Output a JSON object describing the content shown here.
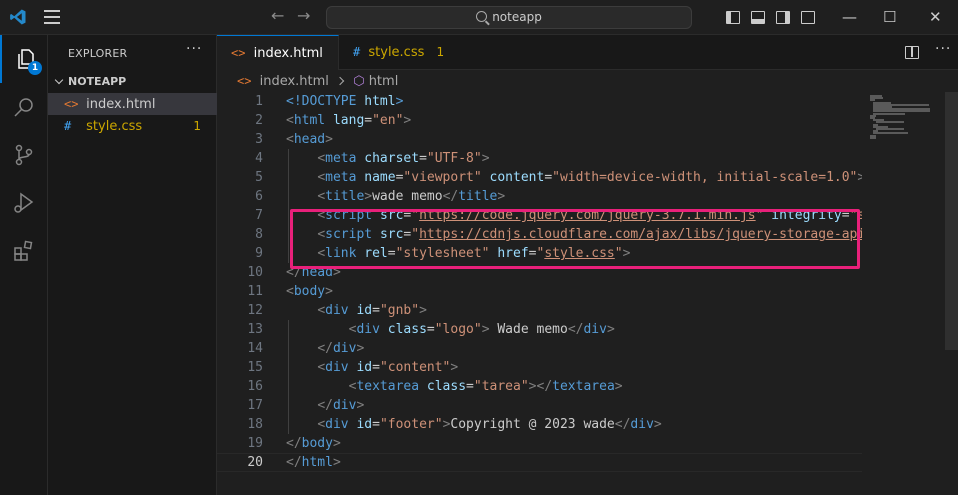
{
  "titlebar": {
    "search_text": "noteapp",
    "nav_back": "←",
    "nav_forward": "→",
    "minimize": "—",
    "maximize": "☐",
    "close": "✕"
  },
  "activity": {
    "explorer_badge": "1"
  },
  "sidebar": {
    "title": "EXPLORER",
    "more": "···",
    "folder": "NOTEAPP",
    "files": [
      {
        "name": "index.html",
        "icon": "<>",
        "icon_color": "#e37933"
      },
      {
        "name": "style.css",
        "icon": "#",
        "icon_color": "#42a5f5",
        "count": "1"
      }
    ]
  },
  "tabs": [
    {
      "label": "index.html",
      "icon": "<>",
      "icon_color": "#e37933"
    },
    {
      "label": "style.css",
      "icon": "#",
      "icon_color": "#42a5f5",
      "count": "1"
    }
  ],
  "tab_more": "···",
  "breadcrumb": {
    "file": "index.html",
    "symbol": "html"
  },
  "editor": {
    "current_line": "20",
    "line_numbers": [
      "1",
      "2",
      "3",
      "4",
      "5",
      "6",
      "7",
      "8",
      "9",
      "10",
      "11",
      "12",
      "13",
      "14",
      "15",
      "16",
      "17",
      "18",
      "19",
      "20"
    ],
    "lines": [
      [
        [
          "tag",
          "<!DOCTYPE "
        ],
        [
          "attr",
          "html"
        ],
        [
          "tag",
          ">"
        ]
      ],
      [
        [
          "pun",
          "<"
        ],
        [
          "tag",
          "html "
        ],
        [
          "attr",
          "lang"
        ],
        [
          "txt",
          "="
        ],
        [
          "str",
          "\"en\""
        ],
        [
          "pun",
          ">"
        ]
      ],
      [
        [
          "pun",
          "<"
        ],
        [
          "tag",
          "head"
        ],
        [
          "pun",
          ">"
        ]
      ],
      [
        [
          "txt",
          "    "
        ],
        [
          "pun",
          "<"
        ],
        [
          "tag",
          "meta "
        ],
        [
          "attr",
          "charset"
        ],
        [
          "txt",
          "="
        ],
        [
          "str",
          "\"UTF-8\""
        ],
        [
          "pun",
          ">"
        ]
      ],
      [
        [
          "txt",
          "    "
        ],
        [
          "pun",
          "<"
        ],
        [
          "tag",
          "meta "
        ],
        [
          "attr",
          "name"
        ],
        [
          "txt",
          "="
        ],
        [
          "str",
          "\"viewport\" "
        ],
        [
          "attr",
          "content"
        ],
        [
          "txt",
          "="
        ],
        [
          "str",
          "\"width=device-width, initial-scale=1.0\""
        ],
        [
          "pun",
          ">"
        ]
      ],
      [
        [
          "txt",
          "    "
        ],
        [
          "pun",
          "<"
        ],
        [
          "tag",
          "title"
        ],
        [
          "pun",
          ">"
        ],
        [
          "txt",
          "wade memo"
        ],
        [
          "pun",
          "</"
        ],
        [
          "tag",
          "title"
        ],
        [
          "pun",
          ">"
        ]
      ],
      [
        [
          "txt",
          "    "
        ],
        [
          "pun",
          "<"
        ],
        [
          "tag",
          "script "
        ],
        [
          "attr",
          "src"
        ],
        [
          "txt",
          "="
        ],
        [
          "str",
          "\""
        ],
        [
          "url",
          "https://code.jquery.com/jquery-3.7.1.min.js"
        ],
        [
          "str",
          "\" "
        ],
        [
          "attr",
          "integrity"
        ],
        [
          "txt",
          "="
        ],
        [
          "str",
          "\"sh"
        ]
      ],
      [
        [
          "txt",
          "    "
        ],
        [
          "pun",
          "<"
        ],
        [
          "tag",
          "script "
        ],
        [
          "attr",
          "src"
        ],
        [
          "txt",
          "="
        ],
        [
          "str",
          "\""
        ],
        [
          "url",
          "https://cdnjs.cloudflare.com/ajax/libs/jquery-storage-api/"
        ]
      ],
      [
        [
          "txt",
          "    "
        ],
        [
          "pun",
          "<"
        ],
        [
          "tag",
          "link "
        ],
        [
          "attr",
          "rel"
        ],
        [
          "txt",
          "="
        ],
        [
          "str",
          "\"stylesheet\" "
        ],
        [
          "attr",
          "href"
        ],
        [
          "txt",
          "="
        ],
        [
          "str",
          "\""
        ],
        [
          "url",
          "style.css"
        ],
        [
          "str",
          "\""
        ],
        [
          "pun",
          ">"
        ]
      ],
      [
        [
          "pun",
          "</"
        ],
        [
          "tag",
          "head"
        ],
        [
          "pun",
          ">"
        ]
      ],
      [
        [
          "pun",
          "<"
        ],
        [
          "tag",
          "body"
        ],
        [
          "pun",
          ">"
        ]
      ],
      [
        [
          "txt",
          "    "
        ],
        [
          "pun",
          "<"
        ],
        [
          "tag",
          "div "
        ],
        [
          "attr",
          "id"
        ],
        [
          "txt",
          "="
        ],
        [
          "str",
          "\"gnb\""
        ],
        [
          "pun",
          ">"
        ]
      ],
      [
        [
          "txt",
          "        "
        ],
        [
          "pun",
          "<"
        ],
        [
          "tag",
          "div "
        ],
        [
          "attr",
          "class"
        ],
        [
          "txt",
          "="
        ],
        [
          "str",
          "\"logo\""
        ],
        [
          "pun",
          ">"
        ],
        [
          "txt",
          " Wade memo"
        ],
        [
          "pun",
          "</"
        ],
        [
          "tag",
          "div"
        ],
        [
          "pun",
          ">"
        ]
      ],
      [
        [
          "txt",
          "    "
        ],
        [
          "pun",
          "</"
        ],
        [
          "tag",
          "div"
        ],
        [
          "pun",
          ">"
        ]
      ],
      [
        [
          "txt",
          "    "
        ],
        [
          "pun",
          "<"
        ],
        [
          "tag",
          "div "
        ],
        [
          "attr",
          "id"
        ],
        [
          "txt",
          "="
        ],
        [
          "str",
          "\"content\""
        ],
        [
          "pun",
          ">"
        ]
      ],
      [
        [
          "txt",
          "        "
        ],
        [
          "pun",
          "<"
        ],
        [
          "tag",
          "textarea "
        ],
        [
          "attr",
          "class"
        ],
        [
          "txt",
          "="
        ],
        [
          "str",
          "\"tarea\""
        ],
        [
          "pun",
          "></"
        ],
        [
          "tag",
          "textarea"
        ],
        [
          "pun",
          ">"
        ]
      ],
      [
        [
          "txt",
          "    "
        ],
        [
          "pun",
          "</"
        ],
        [
          "tag",
          "div"
        ],
        [
          "pun",
          ">"
        ]
      ],
      [
        [
          "txt",
          "    "
        ],
        [
          "pun",
          "<"
        ],
        [
          "tag",
          "div "
        ],
        [
          "attr",
          "id"
        ],
        [
          "txt",
          "="
        ],
        [
          "str",
          "\"footer\""
        ],
        [
          "pun",
          ">"
        ],
        [
          "txt",
          "Copyright @ 2023 wade"
        ],
        [
          "pun",
          "</"
        ],
        [
          "tag",
          "div"
        ],
        [
          "pun",
          ">"
        ]
      ],
      [
        [
          "pun",
          "</"
        ],
        [
          "tag",
          "body"
        ],
        [
          "pun",
          ">"
        ]
      ],
      [
        [
          "pun",
          "</"
        ],
        [
          "tag",
          "html"
        ],
        [
          "pun",
          ">"
        ]
      ]
    ]
  },
  "colors": {
    "accent": "#0078d4",
    "highlight_box": "#e8207a",
    "warning_count": "#cca700"
  }
}
